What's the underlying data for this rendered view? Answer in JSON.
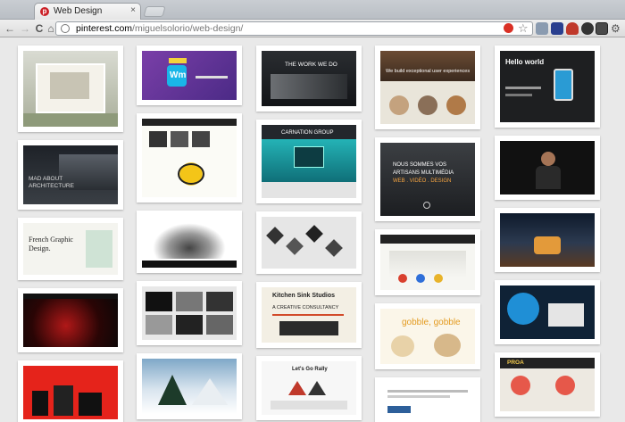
{
  "browser": {
    "tab_title": "Web Design",
    "tab_close": "×",
    "url_host": "pinterest.com",
    "url_path": "/miguelsolorio/web-design/",
    "nav": {
      "back": "←",
      "forward": "→",
      "reload": "C",
      "home": "⌂"
    }
  },
  "pins": {
    "c2": {
      "wordmark": "Wm"
    },
    "c3": {
      "title": "THE WORK WE DO",
      "carnation": "CARNATION GROUP"
    },
    "c4": {
      "tagline": "We build exceptional user experiences",
      "artisans": [
        "NOUS SOMMES VOS",
        "ARTISANS MULTIMÉDIA",
        "WEB . VIDÉO . DESIGN"
      ],
      "gobble": "gobble, gobble"
    },
    "c5": {
      "hello": "Hello world",
      "proa": "PROA"
    },
    "c1": {
      "mad": [
        "MAD ABOUT",
        "ARCHITECTURE"
      ],
      "french": [
        "French Graphic",
        "Design."
      ]
    },
    "c3b": {
      "kitchen": "Kitchen Sink Studios",
      "consultancy": "A CREATIVE CONSULTANCY",
      "rally": "Let's Go Rally"
    }
  }
}
